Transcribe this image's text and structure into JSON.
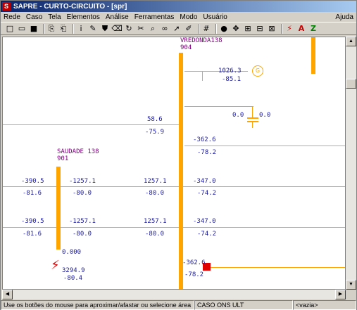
{
  "window": {
    "title": "SAPRE - CURTO-CIRCUITO - [spr]",
    "app_icon_letter": "S"
  },
  "menu": [
    "Rede",
    "Caso",
    "Tela",
    "Elementos",
    "Análise",
    "Ferramentas",
    "Modo",
    "Usuário"
  ],
  "menu_help": "Ajuda",
  "toolbar_icons": [
    "new-file-icon",
    "open-folder-icon",
    "save-icon",
    "copy-icon",
    "paste-icon",
    "info-icon",
    "pencil-icon",
    "stamp-icon",
    "eraser-icon",
    "refresh-icon",
    "cut-icon",
    "zoom-icon",
    "link-icon",
    "arrow-icon",
    "brush-icon",
    "grid-icon",
    "color-icon",
    "move-icon",
    "report-icon",
    "grid-view-icon",
    "export-icon",
    "fault-icon",
    "a-icon",
    "z-icon"
  ],
  "toolbar_glyphs": [
    "□",
    "▭",
    "■",
    "⎘",
    "⎗",
    "i",
    "✎",
    "⛊",
    "⌫",
    "↻",
    "✂",
    "⌕",
    "∞",
    "➚",
    "✐",
    "#",
    "●",
    "✥",
    "⊞",
    "⊟",
    "⊠",
    "⚡",
    "A",
    "Z"
  ],
  "colors": {
    "bus": "#ffa500",
    "value_text": "#1a1aa0",
    "bus_name_text": "#800080",
    "fault_marker": "#e00000"
  },
  "diagram": {
    "bus_vredonda": {
      "name": "VREDONDA138",
      "number": "904"
    },
    "bus_saudade": {
      "name": "SAUDADE 138",
      "number": "901"
    },
    "generator": {
      "p": "1026.3",
      "q": "-85.1"
    },
    "capacitor": {
      "left": "0.0",
      "right": "0.0"
    },
    "left_line": {
      "p": "58.6",
      "q": "-75.9"
    },
    "right_upper_line": {
      "p": "-362.6",
      "q": "-78.2"
    },
    "line_row1": {
      "a1": "-390.5",
      "a2": "-81.6",
      "b1": "-1257.1",
      "b2": "-80.0",
      "c1": "1257.1",
      "c2": "-80.0",
      "d1": "-347.0",
      "d2": "-74.2"
    },
    "line_row2": {
      "a1": "-390.5",
      "a2": "-81.6",
      "b1": "-1257.1",
      "b2": "-80.0",
      "c1": "1257.1",
      "c2": "-80.0",
      "d1": "-347.0",
      "d2": "-74.2"
    },
    "saudade_shunt": "0.000",
    "fault": {
      "p": "3294.9",
      "q": "-80.4"
    },
    "bottom_line": {
      "p": "-362.6",
      "q": "-78.2"
    }
  },
  "status": {
    "hint": "Use os botões do mouse para aproximar/afastar ou selecione área",
    "case": "CASO ONS ULT",
    "selection": "<vazia>"
  }
}
